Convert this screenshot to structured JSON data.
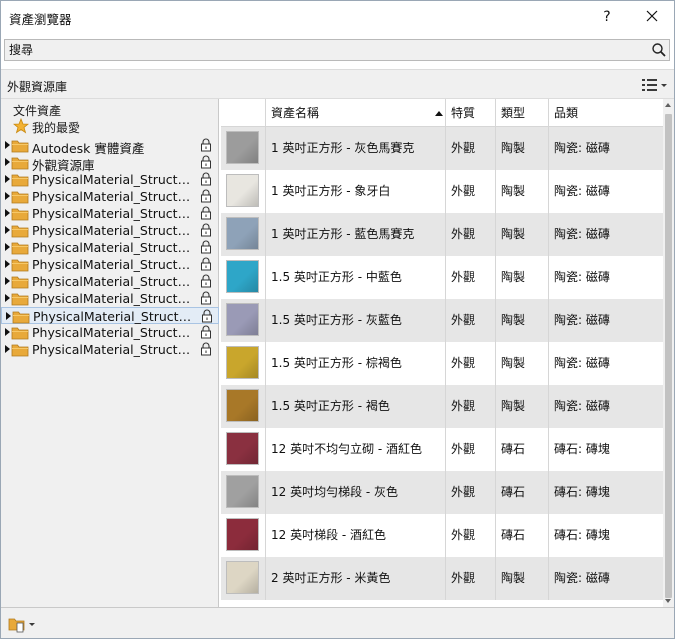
{
  "window": {
    "title": "資產瀏覽器",
    "help_label": "?"
  },
  "search": {
    "placeholder": "搜尋",
    "value": ""
  },
  "library_header": {
    "title": "外觀資源庫"
  },
  "tree": {
    "document_assets": "文件資產",
    "favorites": "我的最愛",
    "libraries": [
      {
        "label": "Autodesk 實體資產",
        "locked": true,
        "selected": false
      },
      {
        "label": "外觀資源庫",
        "locked": true,
        "selected": false
      },
      {
        "label": "PhysicalMaterial_Structur...",
        "locked": true,
        "selected": false
      },
      {
        "label": "PhysicalMaterial_Structur...",
        "locked": true,
        "selected": false
      },
      {
        "label": "PhysicalMaterial_Structur...",
        "locked": true,
        "selected": false
      },
      {
        "label": "PhysicalMaterial_Structur...",
        "locked": true,
        "selected": false
      },
      {
        "label": "PhysicalMaterial_Structur...",
        "locked": true,
        "selected": false
      },
      {
        "label": "PhysicalMaterial_Structur...",
        "locked": true,
        "selected": false
      },
      {
        "label": "PhysicalMaterial_Structur...",
        "locked": true,
        "selected": false
      },
      {
        "label": "PhysicalMaterial_Structur...",
        "locked": true,
        "selected": false
      },
      {
        "label": "PhysicalMaterial_Structur...",
        "locked": true,
        "selected": true
      },
      {
        "label": "PhysicalMaterial_Structur...",
        "locked": true,
        "selected": false
      },
      {
        "label": "PhysicalMaterial_Structur...",
        "locked": true,
        "selected": false
      }
    ]
  },
  "table": {
    "columns": [
      "",
      "資產名稱",
      "特質",
      "類型",
      "品類"
    ],
    "rows": [
      {
        "name": "1 英吋正方形 - 灰色馬賽克",
        "trait": "外觀",
        "type": "陶製",
        "category": "陶瓷: 磁磚",
        "swatch": "#9c9c9c"
      },
      {
        "name": "1 英吋正方形 - 象牙白",
        "trait": "外觀",
        "type": "陶製",
        "category": "陶瓷: 磁磚",
        "swatch": "#e8e6e0"
      },
      {
        "name": "1 英吋正方形 - 藍色馬賽克",
        "trait": "外觀",
        "type": "陶製",
        "category": "陶瓷: 磁磚",
        "swatch": "#8ea2b8"
      },
      {
        "name": "1.5 英吋正方形 - 中藍色",
        "trait": "外觀",
        "type": "陶製",
        "category": "陶瓷: 磁磚",
        "swatch": "#2ea6c8"
      },
      {
        "name": "1.5 英吋正方形 - 灰藍色",
        "trait": "外觀",
        "type": "陶製",
        "category": "陶瓷: 磁磚",
        "swatch": "#9a9ab6"
      },
      {
        "name": "1.5 英吋正方形 - 棕褐色",
        "trait": "外觀",
        "type": "陶製",
        "category": "陶瓷: 磁磚",
        "swatch": "#c9a62c"
      },
      {
        "name": "1.5 英吋正方形 - 褐色",
        "trait": "外觀",
        "type": "陶製",
        "category": "陶瓷: 磁磚",
        "swatch": "#a87828"
      },
      {
        "name": "12 英吋不均勻立砌 - 酒紅色",
        "trait": "外觀",
        "type": "磚石",
        "category": "磚石: 磚塊",
        "swatch": "#8a3040"
      },
      {
        "name": "12 英吋均勻梯段 - 灰色",
        "trait": "外觀",
        "type": "磚石",
        "category": "磚石: 磚塊",
        "swatch": "#a0a0a0"
      },
      {
        "name": "12 英吋梯段 - 酒紅色",
        "trait": "外觀",
        "type": "磚石",
        "category": "磚石: 磚塊",
        "swatch": "#8c2c3c"
      },
      {
        "name": "2 英吋正方形 - 米黃色",
        "trait": "外觀",
        "type": "陶製",
        "category": "陶瓷: 磁磚",
        "swatch": "#ddd6c4"
      }
    ]
  },
  "colors": {
    "selection_bg": "#e3ecf6",
    "alt_row": "#e6e6e6",
    "folder": "#e8a93a",
    "star": "#f3b233"
  }
}
